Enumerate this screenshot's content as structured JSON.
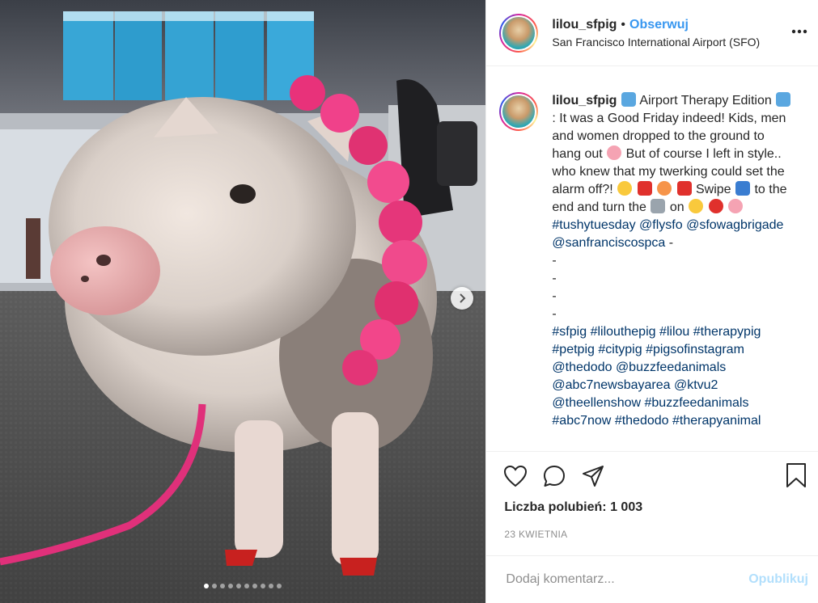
{
  "header": {
    "username": "lilou_sfpig",
    "separator": "•",
    "follow_label": "Obserwuj",
    "location": "San Francisco International Airport (SFO)"
  },
  "caption": {
    "username": "lilou_sfpig",
    "t1": "Airport Therapy Edition",
    "t2": ": It was a Good Friday indeed! Kids, men and women dropped to the ground to hang out",
    "t3": "But of course I left in style.. who knew that my twerking could set the alarm off?!",
    "t4": "Swipe",
    "t5": "to the end and turn the",
    "t6": "on",
    "tags1": [
      "#tushytuesday",
      "@flysfo",
      "@sfowagbrigade",
      "@sanfranciscospca"
    ],
    "dash": "-",
    "tags2": [
      "#sfpig",
      "#lilouthepig",
      "#lilou",
      "#therapypig",
      "#petpig",
      "#citypig",
      "#pigsofinstagram",
      "@thedodo",
      "@buzzfeedanimals",
      "@abc7newsbayarea",
      "@ktvu2",
      "@theellenshow",
      "#buzzfeedanimals",
      "#abc7now",
      "#thedodo",
      "#therapyanimal"
    ]
  },
  "icons": {
    "more": "more-dots-icon",
    "like": "heart-icon",
    "comment": "comment-bubble-icon",
    "share": "share-arrow-icon",
    "save": "bookmark-icon",
    "next": "chevron-right-icon"
  },
  "likes_text": "Liczba polubień: 1 003",
  "date": "23 KWIETNIA",
  "comment": {
    "placeholder": "Dodaj komentarz...",
    "publish_label": "Opublikuj"
  },
  "carousel": {
    "total": 10,
    "current": 1
  },
  "colors": {
    "follow": "#3897f0",
    "tag": "#003569",
    "publish_disabled": "#b2dffc",
    "muted": "#8e8e8e"
  }
}
